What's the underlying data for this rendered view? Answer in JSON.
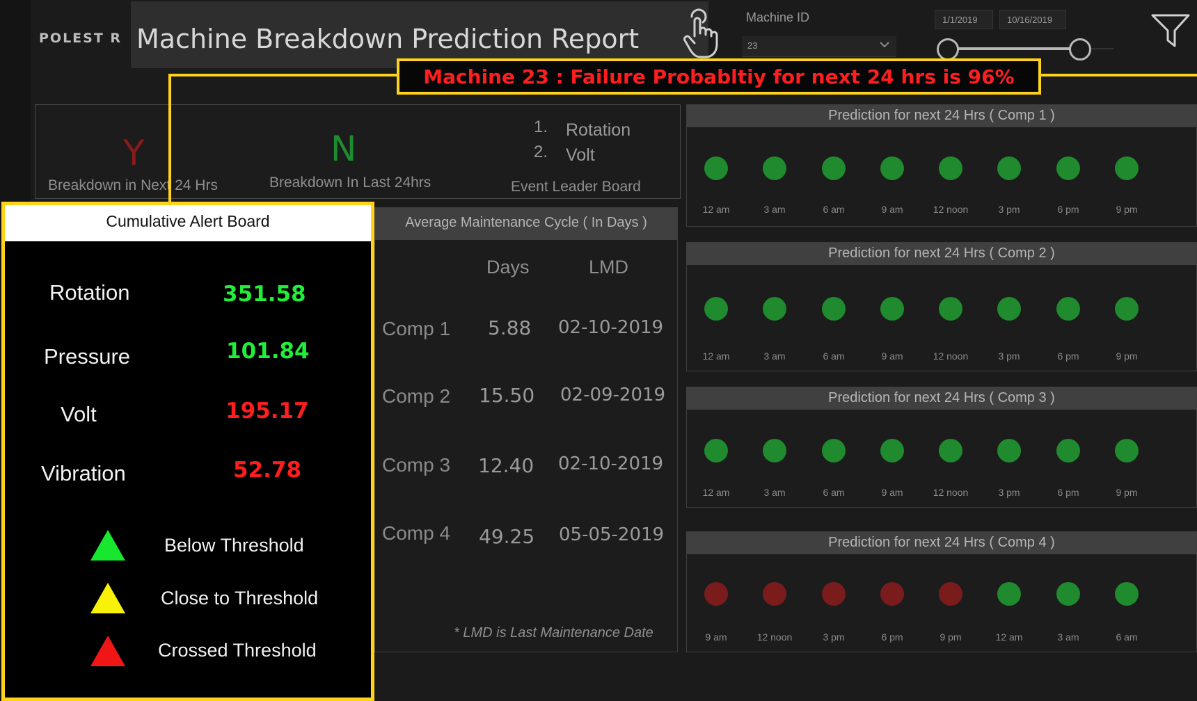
{
  "header": {
    "logo": "POLEST R",
    "title": "Machine Breakdown Prediction Report",
    "machine_id_label": "Machine ID",
    "machine_id_value": "23",
    "date_start": "1/1/2019",
    "date_end": "10/16/2019"
  },
  "banner": {
    "text": "Machine 23 :  Failure Probabltiy for next 24 hrs is 96%"
  },
  "kpis": {
    "breakdown_next": {
      "value": "Y",
      "label": "Breakdown in Next 24 Hrs"
    },
    "breakdown_last": {
      "value": "N",
      "label": "Breakdown In Last 24hrs"
    },
    "leader_board": {
      "items": [
        {
          "num": "1.",
          "name": "Rotation"
        },
        {
          "num": "2.",
          "name": "Volt"
        }
      ],
      "label": "Event Leader Board"
    }
  },
  "alert_board": {
    "title": "Cumulative Alert Board",
    "metrics": [
      {
        "label": "Rotation",
        "value": "351.58",
        "color": "#22ee3a"
      },
      {
        "label": "Pressure",
        "value": "101.84",
        "color": "#22ee3a"
      },
      {
        "label": "Volt",
        "value": "195.17",
        "color": "#ff1e1e"
      },
      {
        "label": "Vibration",
        "value": "52.78",
        "color": "#ff1e1e"
      }
    ],
    "legend": [
      {
        "label": "Below Threshold",
        "color": "#17e82f"
      },
      {
        "label": "Close to Threshold",
        "color": "#f7f207"
      },
      {
        "label": "Crossed Threshold",
        "color": "#f01616"
      }
    ]
  },
  "maintenance": {
    "title": "Average Maintenance Cycle ( In Days )",
    "col_days": "Days",
    "col_lmd": "LMD",
    "rows": [
      {
        "comp": "Comp 1",
        "days": "5.88",
        "lmd": "02-10-2019"
      },
      {
        "comp": "Comp 2",
        "days": "15.50",
        "lmd": "02-09-2019"
      },
      {
        "comp": "Comp 3",
        "days": "12.40",
        "lmd": "02-10-2019"
      },
      {
        "comp": "Comp 4",
        "days": "49.25",
        "lmd": "05-05-2019"
      }
    ],
    "footnote": "* LMD is Last Maintenance Date"
  },
  "status_colors": {
    "ok": "#1f8a2e",
    "fail": "#7a1c1c"
  },
  "predictions": [
    {
      "title": "Prediction for next 24 Hrs ( Comp 1 )",
      "times": [
        "12 am",
        "3 am",
        "6 am",
        "9 am",
        "12 noon",
        "3 pm",
        "6 pm",
        "9 pm"
      ],
      "status": [
        "ok",
        "ok",
        "ok",
        "ok",
        "ok",
        "ok",
        "ok",
        "ok"
      ]
    },
    {
      "title": "Prediction for next 24 Hrs ( Comp 2 )",
      "times": [
        "12 am",
        "3 am",
        "6 am",
        "9 am",
        "12 noon",
        "3 pm",
        "6 pm",
        "9 pm"
      ],
      "status": [
        "ok",
        "ok",
        "ok",
        "ok",
        "ok",
        "ok",
        "ok",
        "ok"
      ]
    },
    {
      "title": "Prediction for next 24 Hrs ( Comp 3 )",
      "times": [
        "12 am",
        "3 am",
        "6 am",
        "9 am",
        "12 noon",
        "3 pm",
        "6 pm",
        "9 pm"
      ],
      "status": [
        "ok",
        "ok",
        "ok",
        "ok",
        "ok",
        "ok",
        "ok",
        "ok"
      ]
    },
    {
      "title": "Prediction for next 24 Hrs ( Comp 4 )",
      "times": [
        "9 am",
        "12 noon",
        "3 pm",
        "6 pm",
        "9 pm",
        "12 am",
        "3 am",
        "6 am"
      ],
      "status": [
        "fail",
        "fail",
        "fail",
        "fail",
        "fail",
        "ok",
        "ok",
        "ok"
      ]
    }
  ]
}
